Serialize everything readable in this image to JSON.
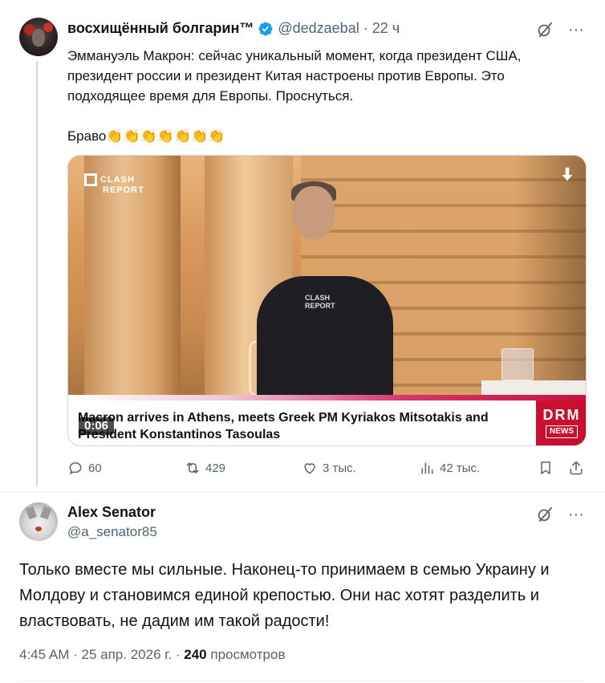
{
  "tweet1": {
    "display_name": "восхищённый болгарин™",
    "handle": "@dedzaebal",
    "separator": "·",
    "time": "22 ч",
    "text_lines": [
      "Эммануэль Макрон: сейчас уникальный момент, когда президент США,",
      "президент россии и президент Китая настроены против Европы. Это",
      "подходящее время для Европы. Проснуться."
    ],
    "text_bravo": "Браво",
    "claps": "👏👏👏👏👏👏👏",
    "media": {
      "logo_text_1": "CLASH",
      "logo_text_2": "REPORT",
      "watermark_1": "CLASH",
      "watermark_2": "REPORT",
      "lower_third": "Macron arrives in Athens, meets Greek PM Kyriakos Mitsotakis and President Konstantinos Tasoulas",
      "duration": "0:06",
      "channel_logo_1": "DRM",
      "channel_logo_2": "NEWS"
    },
    "actions": {
      "replies": "60",
      "reposts": "429",
      "likes": "3 тыс.",
      "views": "42 тыс."
    }
  },
  "tweet2": {
    "display_name": "Alex Senator",
    "handle": "@a_senator85",
    "text": "Только вместе мы сильные. Наконец-то принимаем в семью Украину и Молдову и становимся единой крепостью. Они нас хотят разделить и властвовать, не дадим им такой радости!",
    "time": "4:45 AM",
    "date": "25 апр. 2026 г.",
    "separator": "·",
    "views_count": "240",
    "views_label": "просмотров"
  },
  "colors": {
    "verified": "#1d9bf0",
    "secondary_text": "#536471",
    "primary_text": "#0f1419",
    "drm_red": "#c8102e"
  },
  "icons": [
    "verified-badge-icon",
    "grok-icon",
    "more-icon",
    "download-icon",
    "reply-icon",
    "repost-icon",
    "like-icon",
    "views-icon",
    "bookmark-icon",
    "share-icon"
  ]
}
